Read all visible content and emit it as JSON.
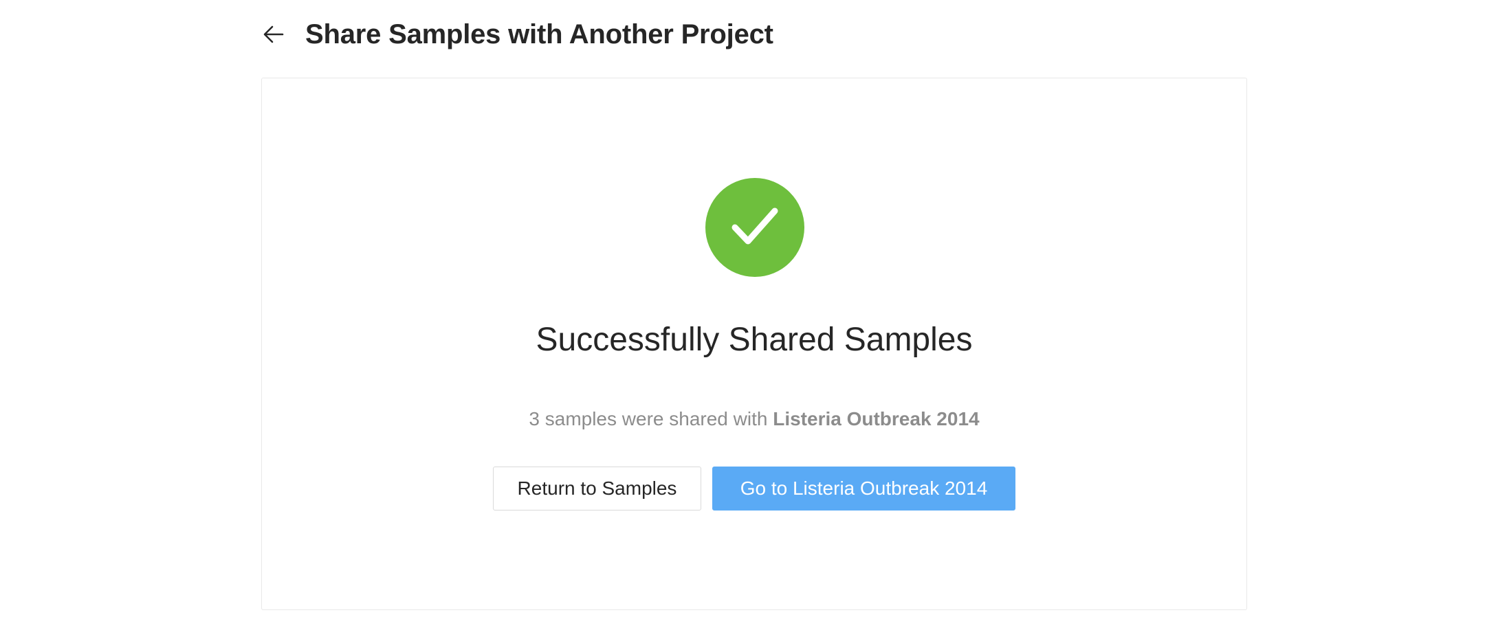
{
  "header": {
    "back_icon": "arrow-left-icon",
    "title": "Share Samples with Another Project"
  },
  "result": {
    "status_icon": "check-circle-icon",
    "status_color": "#6ebf3d",
    "title": "Successfully Shared Samples",
    "subtitle_prefix": "3 samples were shared with ",
    "project_name": "Listeria Outbreak 2014",
    "sample_count": 3
  },
  "actions": {
    "return_label": "Return to Samples",
    "goto_label": "Go to Listeria Outbreak 2014"
  },
  "colors": {
    "primary": "#5aaaf5",
    "success": "#6ebf3d"
  }
}
